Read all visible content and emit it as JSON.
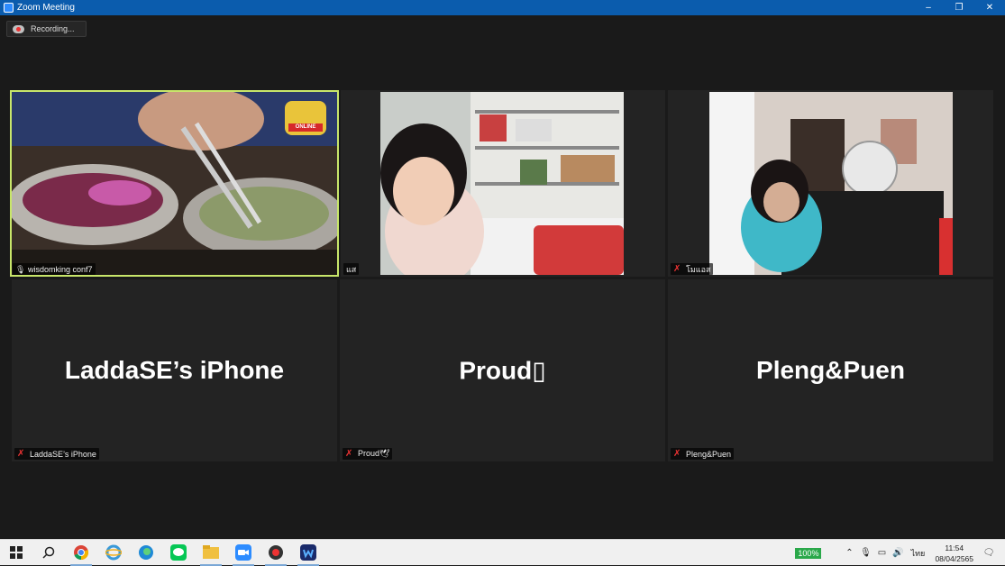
{
  "window": {
    "title": "Zoom Meeting",
    "minimize": "–",
    "restore": "❐",
    "close": "✕"
  },
  "recording": {
    "label": "Recording..."
  },
  "tiles": [
    {
      "name": "wisdomking conf7",
      "muted": false,
      "video": "cooking",
      "overlay_badge": "ONLINE"
    },
    {
      "name": "แส",
      "muted": false,
      "video": "child-shelf"
    },
    {
      "name": "โมแอส",
      "muted": true,
      "video": "child-room"
    },
    {
      "name": "LaddaSE’s iPhone",
      "big_name": "LaddaSE’s iPhone",
      "muted": true
    },
    {
      "name": "Proud🕊",
      "big_name": "Proud▯",
      "muted": true
    },
    {
      "name": "Pleng&Puen",
      "big_name": "Pleng&Puen",
      "muted": true
    }
  ],
  "taskbar": {
    "apps": [
      "start",
      "search",
      "chrome",
      "ie",
      "edge",
      "line",
      "files",
      "zoom",
      "capture",
      "app"
    ],
    "battery": "100%",
    "language": "ไทย",
    "time": "11:54",
    "date": "08/04/2565"
  },
  "colors": {
    "active_speaker": "#c8e66a",
    "titlebar": "#0b5cad"
  }
}
